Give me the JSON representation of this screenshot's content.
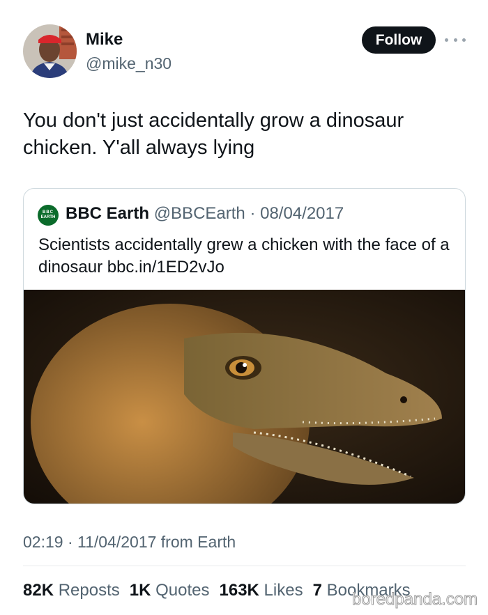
{
  "author": {
    "name": "Mike",
    "handle": "@mike_n30",
    "follow_label": "Follow",
    "avatar_icon": "profile-photo"
  },
  "tweet": {
    "text": "You don't just accidentally grow a dinosaur chicken. Y'all always lying",
    "timestamp": "02:19 · 11/04/2017 from Earth"
  },
  "quote": {
    "logo_line1": "BBC",
    "logo_line2": "EARTH",
    "name": "BBC Earth",
    "handle": "@BBCEarth",
    "date": "· 08/04/2017",
    "text": "Scientists accidentally grew a chicken with the face of a dinosaur bbc.in/1ED2vJo",
    "image_desc_icon": "dinosaur-chicken-photo"
  },
  "stats": [
    {
      "value": "82K",
      "label": "Reposts"
    },
    {
      "value": "1K",
      "label": "Quotes"
    },
    {
      "value": "163K",
      "label": "Likes"
    },
    {
      "value": "7",
      "label": "Bookmarks"
    }
  ],
  "watermark": "boredpanda.com",
  "colors": {
    "text": "#0f1419",
    "secondary": "#536471",
    "follow_bg": "#0f1419",
    "bbc_green": "#0b6b2b"
  }
}
